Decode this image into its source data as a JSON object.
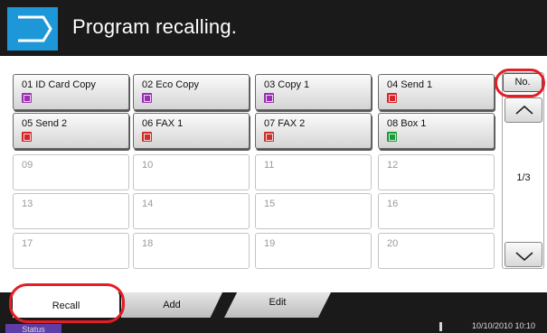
{
  "header": {
    "title": "Program recalling.",
    "accent_color": "#1d97d8",
    "icon": "program-arrow-icon"
  },
  "programs": [
    {
      "label": "01 ID Card Copy",
      "icon": "copy-icon",
      "color": "#9a2fb0"
    },
    {
      "label": "02 Eco Copy",
      "icon": "copy-icon",
      "color": "#9a2fb0"
    },
    {
      "label": "03 Copy 1",
      "icon": "copy-icon",
      "color": "#9a2fb0"
    },
    {
      "label": "04 Send 1",
      "icon": "send-icon",
      "color": "#d8232a"
    },
    {
      "label": "05 Send 2",
      "icon": "send-icon",
      "color": "#d8232a"
    },
    {
      "label": "06 FAX 1",
      "icon": "fax-icon",
      "color": "#c8312c"
    },
    {
      "label": "07 FAX 2",
      "icon": "fax-icon",
      "color": "#c8312c"
    },
    {
      "label": "08 Box 1",
      "icon": "box-icon",
      "color": "#1a9a3a"
    },
    {
      "label": "09"
    },
    {
      "label": "10"
    },
    {
      "label": "11"
    },
    {
      "label": "12"
    },
    {
      "label": "13"
    },
    {
      "label": "14"
    },
    {
      "label": "15"
    },
    {
      "label": "16"
    },
    {
      "label": "17"
    },
    {
      "label": "18"
    },
    {
      "label": "19"
    },
    {
      "label": "20"
    }
  ],
  "side_panel": {
    "no_label": "No.",
    "page_indicator": "1/3",
    "up_icon": "chevron-up-icon",
    "down_icon": "chevron-down-icon"
  },
  "tabs": {
    "recall": "Recall",
    "add": "Add",
    "edit": "Edit"
  },
  "status_bar": {
    "status_label": "Status",
    "datetime": "10/10/2010 10:10"
  },
  "highlight_color": "#e31e24"
}
